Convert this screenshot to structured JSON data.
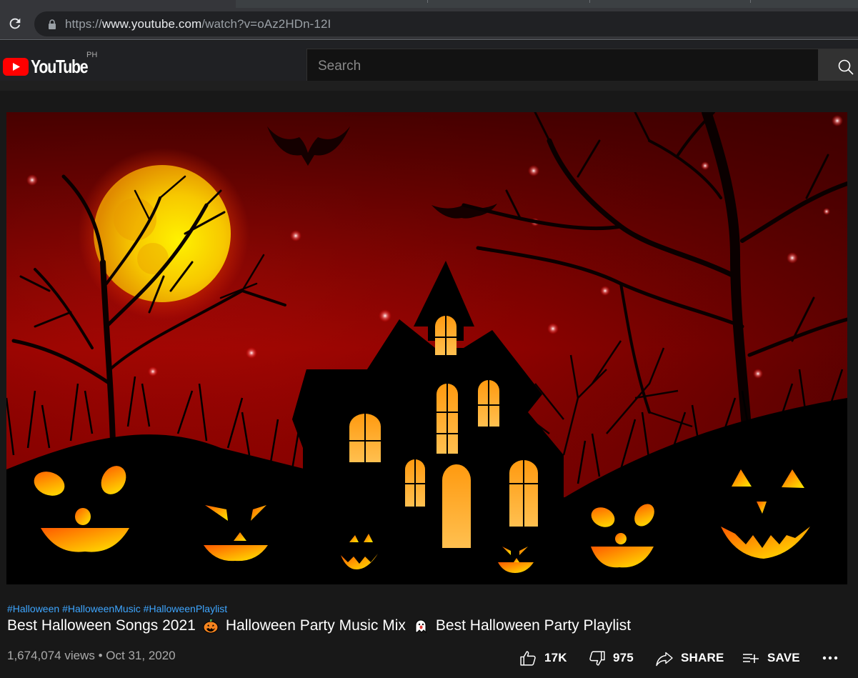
{
  "browser": {
    "url_scheme": "https://",
    "url_host": "www.youtube.com",
    "url_path": "/watch?v=oAz2HDn-12I"
  },
  "header": {
    "logo_text": "YouTube",
    "region_code": "PH",
    "search_placeholder": "Search",
    "search_value": ""
  },
  "video": {
    "description_alt": "Haunted house with glowing windows under a full moon, bare trees, bats and jack-o'-lanterns on a red sky",
    "hashtags": [
      "#Halloween",
      "#HalloweenMusic",
      "#HalloweenPlaylist"
    ],
    "title_part1": "Best Halloween Songs 2021",
    "title_emoji1": "jack-o-lantern",
    "title_part2": "Halloween Party Music Mix",
    "title_emoji2": "ghost",
    "title_part3": "Best Halloween Party Playlist",
    "views": "1,674,074 views",
    "separator": "•",
    "date": "Oct 31, 2020"
  },
  "actions": {
    "like_count": "17K",
    "dislike_count": "975",
    "share_label": "SHARE",
    "save_label": "SAVE",
    "more_label": "..."
  },
  "colors": {
    "brand_red": "#ff0000",
    "link_blue": "#3ea6ff",
    "background": "#181818",
    "secondary_text": "#aaaaaa"
  }
}
